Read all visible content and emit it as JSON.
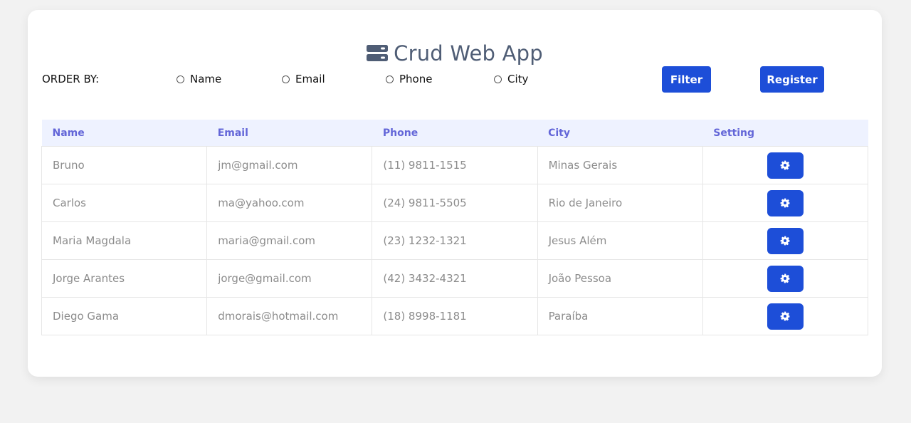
{
  "app": {
    "title": "Crud Web App",
    "title_icon": "server-icon"
  },
  "order": {
    "label": "ORDER BY:",
    "options": [
      "Name",
      "Email",
      "Phone",
      "City"
    ]
  },
  "buttons": {
    "filter": "Filter",
    "register": "Register"
  },
  "colors": {
    "primary": "#1d4ed8",
    "header_text": "#6366d8",
    "header_bg": "#eef2ff",
    "title": "#4f5d75",
    "cell_text": "#8c8c8c"
  },
  "table": {
    "columns": [
      "Name",
      "Email",
      "Phone",
      "City",
      "Setting"
    ],
    "rows": [
      {
        "name": "Bruno",
        "email": "jm@gmail.com",
        "phone": "(11) 9811-1515",
        "city": "Minas Gerais",
        "setting_icon": "gear-icon"
      },
      {
        "name": "Carlos",
        "email": "ma@yahoo.com",
        "phone": "(24) 9811-5505",
        "city": "Rio de Janeiro",
        "setting_icon": "gear-icon"
      },
      {
        "name": "Maria Magdala",
        "email": "maria@gmail.com",
        "phone": "(23) 1232-1321",
        "city": "Jesus Além",
        "setting_icon": "gear-icon"
      },
      {
        "name": "Jorge Arantes",
        "email": "jorge@gmail.com",
        "phone": "(42) 3432-4321",
        "city": "João Pessoa",
        "setting_icon": "gear-icon"
      },
      {
        "name": "Diego Gama",
        "email": "dmorais@hotmail.com",
        "phone": "(18) 8998-1181",
        "city": "Paraíba",
        "setting_icon": "gear-icon"
      }
    ]
  }
}
